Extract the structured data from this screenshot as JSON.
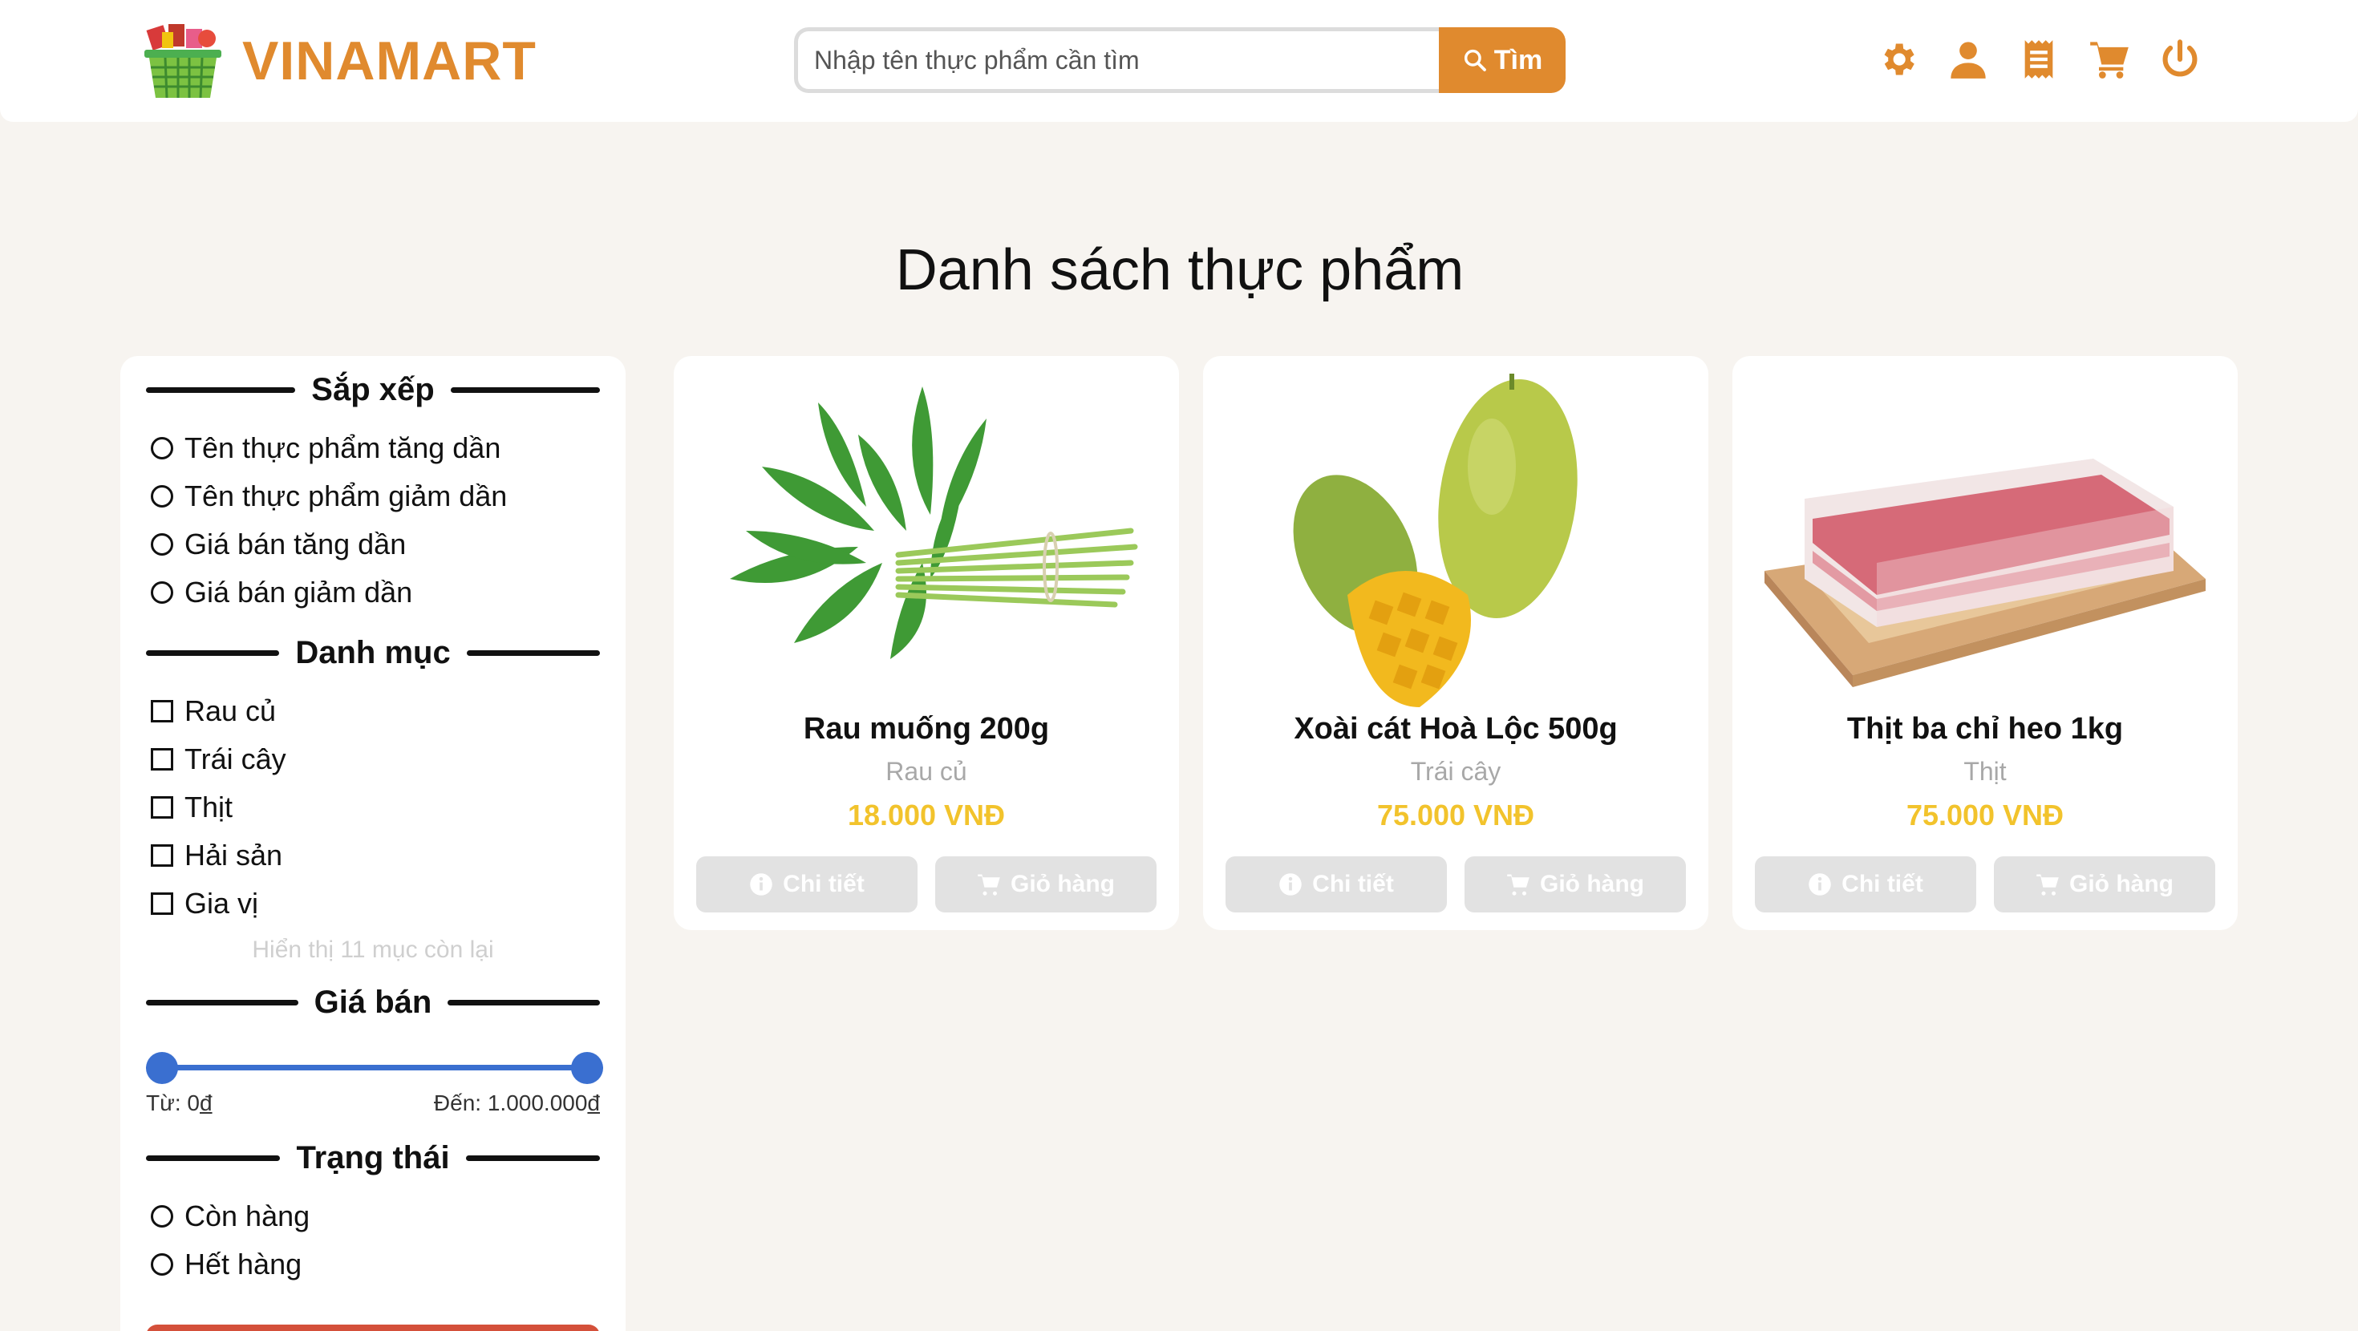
{
  "brand": {
    "name": "VINAMART",
    "accent": "#e08a2e"
  },
  "search": {
    "placeholder": "Nhập tên thực phẩm cần tìm",
    "button_label": "Tìm"
  },
  "nav_icons": [
    "gear-icon",
    "user-icon",
    "receipt-icon",
    "cart-icon",
    "power-icon"
  ],
  "page_title": "Danh sách thực phẩm",
  "sidebar": {
    "sort": {
      "title": "Sắp xếp",
      "options": [
        "Tên thực phẩm tăng dần",
        "Tên thực phẩm giảm dần",
        "Giá bán tăng dần",
        "Giá bán giảm dần"
      ]
    },
    "category": {
      "title": "Danh mục",
      "options": [
        "Rau củ",
        "Trái cây",
        "Thịt",
        "Hải sản",
        "Gia vị"
      ],
      "more_text": "Hiển thị 11 mục còn lại"
    },
    "price": {
      "title": "Giá bán",
      "from_label": "Từ: 0",
      "from_currency": "đ",
      "to_label": "Đến: 1.000.000",
      "to_currency": "đ",
      "min_fraction": 0,
      "max_fraction": 1
    },
    "status": {
      "title": "Trạng thái",
      "options": [
        "Còn hàng",
        "Hết hàng"
      ]
    }
  },
  "products": [
    {
      "name": "Rau muống 200g",
      "category": "Rau củ",
      "price": "18.000 VNĐ",
      "detail_label": "Chi tiết",
      "cart_label": "Giỏ hàng"
    },
    {
      "name": "Xoài cát Hoà Lộc 500g",
      "category": "Trái cây",
      "price": "75.000 VNĐ",
      "detail_label": "Chi tiết",
      "cart_label": "Giỏ hàng"
    },
    {
      "name": "Thịt ba chỉ heo 1kg",
      "category": "Thịt",
      "price": "75.000 VNĐ",
      "detail_label": "Chi tiết",
      "cart_label": "Giỏ hàng"
    }
  ]
}
